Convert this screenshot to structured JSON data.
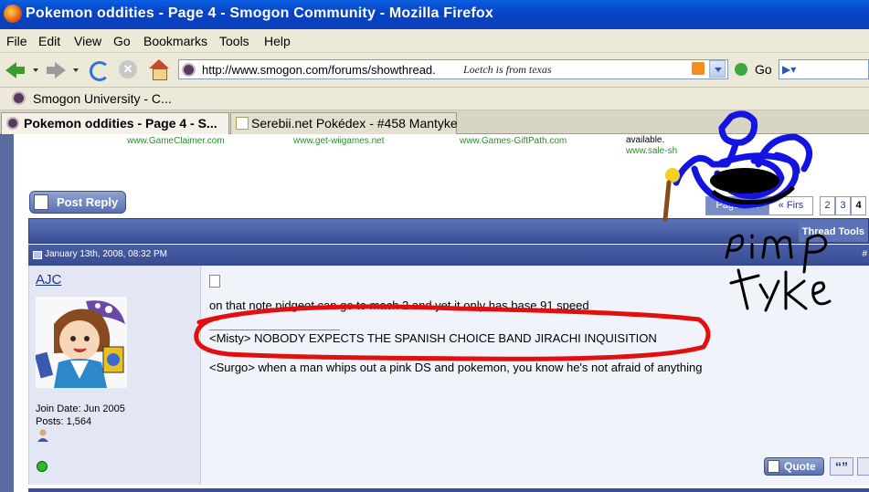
{
  "window": {
    "title": "Pokemon oddities - Page 4 - Smogon Community - Mozilla Firefox"
  },
  "menu": [
    "File",
    "Edit",
    "View",
    "Go",
    "Bookmarks",
    "Tools",
    "Help"
  ],
  "navigation": {
    "url": "http://www.smogon.com/forums/showthread.",
    "url_scribble": "Loetch is from texas",
    "go_label": "Go"
  },
  "bookmarks": {
    "items": [
      "Smogon University - C..."
    ]
  },
  "tabs": [
    {
      "label": "Pokemon oddities - Page 4 - S...",
      "active": true
    },
    {
      "label": "Serebii.net Pokédex - #458 Mantyke",
      "active": false
    }
  ],
  "ads": {
    "links": [
      "www.GameClaimer.com",
      "www.get-wiigames.net",
      "www.Games-GiftPath.com"
    ],
    "available_text": "available.",
    "sale_link": "www.sale-sh"
  },
  "thread": {
    "post_reply_label": "Post Reply",
    "page_label": "Page 4 of",
    "first_label": "« Firs",
    "pages": [
      "2",
      "3",
      "4"
    ],
    "current_page": "4",
    "thread_tools_label": "Thread Tools"
  },
  "post": {
    "date": "January 13th, 2008, 08:32 PM",
    "post_number": "#",
    "username": "AJC",
    "join_date": "Join Date: Jun 2005",
    "posts": "Posts: 1,564",
    "message": "on that note pidgeot can go to mach 2 and yet it only has base 91 speed",
    "sig_line1": "<Misty> NOBODY EXPECTS THE SPANISH CHOICE BAND JIRACHI INQUISITION",
    "sig_line2": "<Surgo> when a man whips out a pink DS and pokemon, you know he's not afraid of anything",
    "quote_label": "Quote",
    "multiquote_label": "“”"
  },
  "doodle": {
    "caption": "pimp tyke",
    "colors": {
      "marker_red": "#e01010",
      "marker_blue": "#1414e0",
      "ink_black": "#000000"
    }
  },
  "colors": {
    "titlebar": "#0a4fd8",
    "forum_blue": "#3b4f98",
    "link_green": "#2e8a2e",
    "link_blue": "#22348a"
  }
}
